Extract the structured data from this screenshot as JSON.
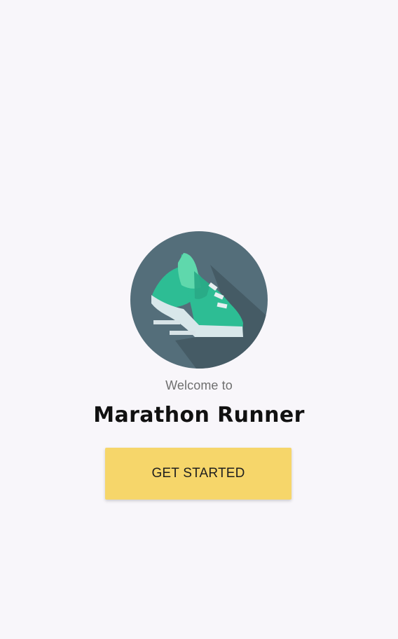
{
  "welcome": {
    "subtitle": "Welcome to",
    "title": "Marathon Runner"
  },
  "logo": {
    "icon": "running-shoe-icon",
    "colors": {
      "circle": "#546e7a",
      "shoe": "#2dbd94",
      "shoe_highlight": "#5fd8ac",
      "sole": "#d8e7ea",
      "shadow": "#455a64"
    }
  },
  "actions": {
    "get_started": "GET STARTED",
    "button_color": "#f6d66a"
  }
}
